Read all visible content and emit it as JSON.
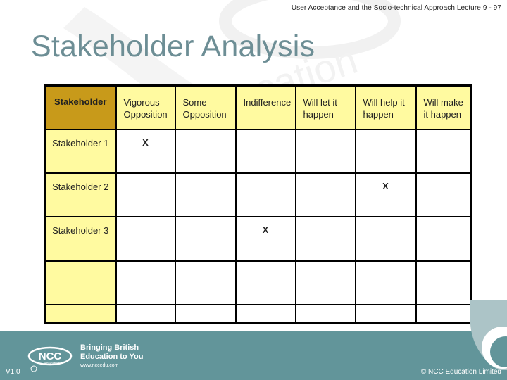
{
  "header": {
    "lecture_title": "User Acceptance and the Socio-technical Approach Lecture 9 - 97"
  },
  "slide": {
    "title": "Stakeholder Analysis"
  },
  "table": {
    "columns": [
      "Stakeholder",
      "Vigorous Opposition",
      "Some Opposition",
      "Indifference",
      "Will let it happen",
      "Will help it happen",
      "Will make it happen"
    ],
    "rows": [
      {
        "label": "Stakeholder 1",
        "cells": [
          "X",
          "",
          "",
          "",
          "",
          ""
        ]
      },
      {
        "label": "Stakeholder 2",
        "cells": [
          "",
          "",
          "",
          "",
          "X",
          ""
        ]
      },
      {
        "label": "Stakeholder 3",
        "cells": [
          "",
          "",
          "X",
          "",
          "",
          ""
        ]
      },
      {
        "label": "",
        "cells": [
          "",
          "",
          "",
          "",
          "",
          ""
        ]
      },
      {
        "label": "",
        "cells": [
          "",
          "",
          "",
          "",
          "",
          ""
        ]
      }
    ]
  },
  "footer": {
    "version": "V1.0",
    "copyright": "© NCC Education Limited",
    "logo_text": "NCC",
    "logo_subtext": "education",
    "tagline_line1": "Bringing British",
    "tagline_line2": "Education to You",
    "url": "www.nccedu.com"
  },
  "colors": {
    "title": "#6d8e95",
    "header_cell": "#fffaa0",
    "header_first_cell": "#c89a1a",
    "footer_band": "#62959a"
  }
}
